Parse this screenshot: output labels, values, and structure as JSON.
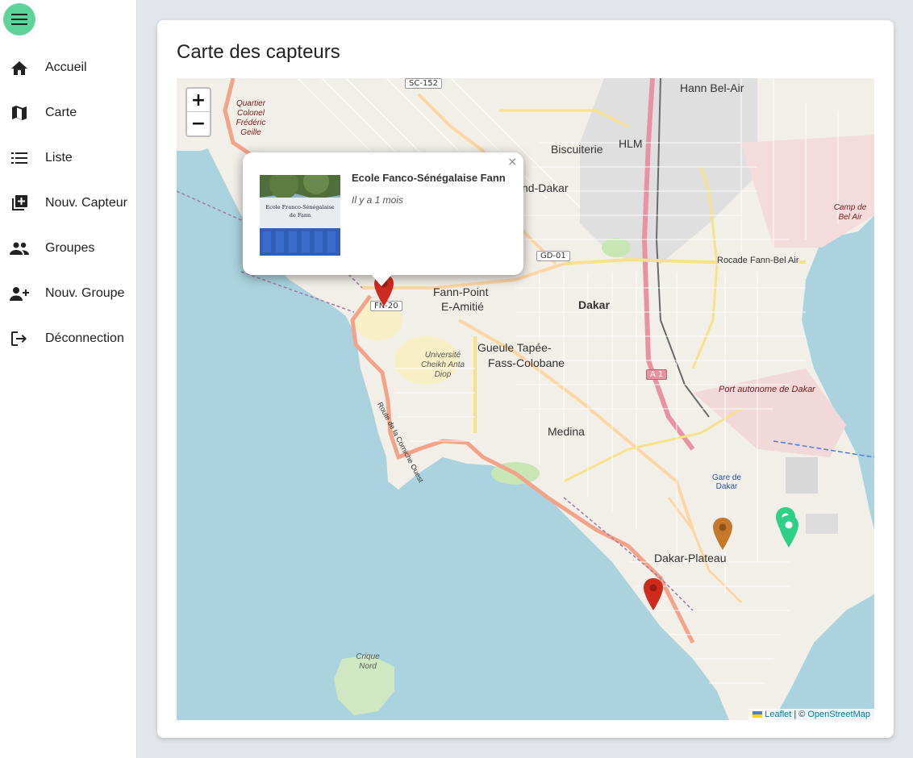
{
  "sidebar": {
    "items": [
      {
        "label": "Accueil",
        "icon": "home-icon"
      },
      {
        "label": "Carte",
        "icon": "map-icon"
      },
      {
        "label": "Liste",
        "icon": "list-icon"
      },
      {
        "label": "Nouv. Capteur",
        "icon": "add-box-icon"
      },
      {
        "label": "Groupes",
        "icon": "group-icon"
      },
      {
        "label": "Nouv. Groupe",
        "icon": "group-add-icon"
      },
      {
        "label": "Déconnection",
        "icon": "logout-icon"
      }
    ]
  },
  "main": {
    "title": "Carte des capteurs"
  },
  "map": {
    "zoom_in": "+",
    "zoom_out": "−",
    "popup": {
      "title": "Ecole Fanco-Sénégalaise Fann",
      "time": "Il y a 1 mois",
      "close": "×",
      "photo_sign": "Ecole Franco-Sénégalaise de Fann"
    },
    "labels": {
      "fann_point": "Fann-Point",
      "e_amitie": "E-Amitié",
      "dakar": "Dakar",
      "gueule": "Gueule Tapée-",
      "fass": "Fass-Colobane",
      "medina": "Medina",
      "plateau": "Dakar-Plateau",
      "biscuiterie": "Biscuiterie",
      "hlm": "HLM",
      "hann": "Hann Bel-Air",
      "grand_dakar": "nd-Dakar",
      "rocade": "Rocade Fann-Bel Air",
      "port": "Port autonome de Dakar",
      "gare": "Gare de Dakar",
      "quartier": "Quartier Colonel Frédéric Geille",
      "camp": "Camp de Bel Air",
      "crique": "Crique Nord",
      "ucad": "Université Cheikh Anta Diop",
      "corniche": "Route de la Corniche Ouest"
    },
    "tags": {
      "fn20": "FN-20",
      "gd01": "GD-01",
      "sc152": "SC-152",
      "a1": "A 1"
    },
    "attribution": {
      "leaflet": "Leaflet",
      "sep": "| ©",
      "osm": "OpenStreetMap"
    },
    "markers": [
      {
        "name": "marker-fann",
        "color": "#cc2b1d"
      },
      {
        "name": "marker-plateau-red",
        "color": "#cc2b1d"
      },
      {
        "name": "marker-orange",
        "color": "#c6782a"
      },
      {
        "name": "marker-green-1",
        "color": "#2ecf86"
      },
      {
        "name": "marker-green-2",
        "color": "#2ecf86"
      }
    ]
  },
  "colors": {
    "accent": "#5fd49a",
    "sea": "#aad3df",
    "land": "#f2efe9"
  }
}
